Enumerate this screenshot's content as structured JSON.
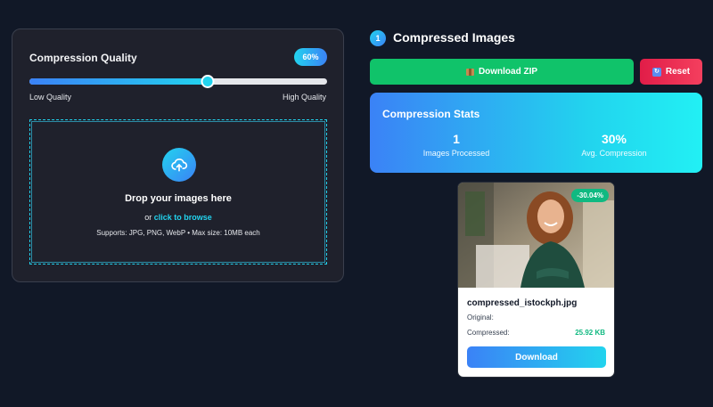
{
  "settings": {
    "quality_title": "Compression Quality",
    "quality_percent": 60,
    "quality_badge": "60%",
    "low_label": "Low Quality",
    "high_label": "High Quality"
  },
  "dropzone": {
    "title": "Drop your images here",
    "or_text": "or ",
    "browse_text": "click to browse",
    "support_text": "Supports: JPG, PNG, WebP • Max size: 10MB each"
  },
  "results": {
    "step_number": "1",
    "title": "Compressed Images",
    "download_zip_label": "Download ZIP",
    "reset_label": "Reset"
  },
  "stats": {
    "title": "Compression Stats",
    "items": [
      {
        "value": "1",
        "label": "Images Processed"
      },
      {
        "value": "30%",
        "label": "Avg. Compression"
      }
    ]
  },
  "image_card": {
    "badge": "-30.04%",
    "file_name": "compressed_istockph.jpg",
    "original_label": "Original:",
    "original_value": "",
    "compressed_label": "Compressed:",
    "compressed_value": "25.92 KB",
    "download_label": "Download"
  },
  "colors": {
    "background": "#111827",
    "panel": "#1f212c",
    "accent_cyan": "#22d3ee",
    "accent_blue": "#3b82f6",
    "success_green": "#10c36a",
    "danger_red": "#e11d48"
  },
  "icons": {
    "upload": "cloud-upload-icon",
    "zip": "package-icon",
    "reset": "refresh-icon"
  }
}
